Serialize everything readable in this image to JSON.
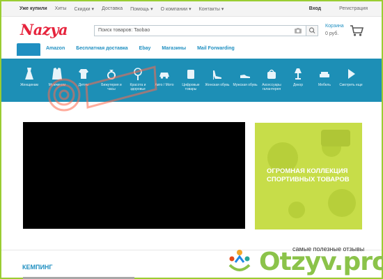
{
  "topbar": {
    "nav": [
      "Уже купили",
      "Хиты",
      "Скидки ▾",
      "Доставка",
      "Помощь ▾",
      "О компании ▾",
      "Контакты ▾"
    ],
    "login": "Вход",
    "register": "Регистрация"
  },
  "logo": "Nazya",
  "search": {
    "placeholder": "Поиск товаров: Taobao"
  },
  "cart": {
    "title": "Корзина",
    "amount": "0 руб."
  },
  "tabs": [
    "",
    "Amazon",
    "Бесплатная доставка",
    "Ebay",
    "Магазины",
    "Mail Forwarding"
  ],
  "categories": [
    "Женщинам",
    "Мужчинам",
    "Детям",
    "Бижутерия и часы",
    "Красота и здоровье",
    "Авто / Мото",
    "Цифровые товары",
    "Женская обувь",
    "Мужская обувь",
    "Аксессуары галантерея",
    "Декор",
    "Мебель",
    "Смотреть еще"
  ],
  "banner": {
    "line1": "Огромная коллекция",
    "line2": "спортивных товаров"
  },
  "section_title": "КЕМПИНГ",
  "watermark": {
    "name": "Otzyv.pro",
    "tagline": "самые полезные отзывы"
  }
}
